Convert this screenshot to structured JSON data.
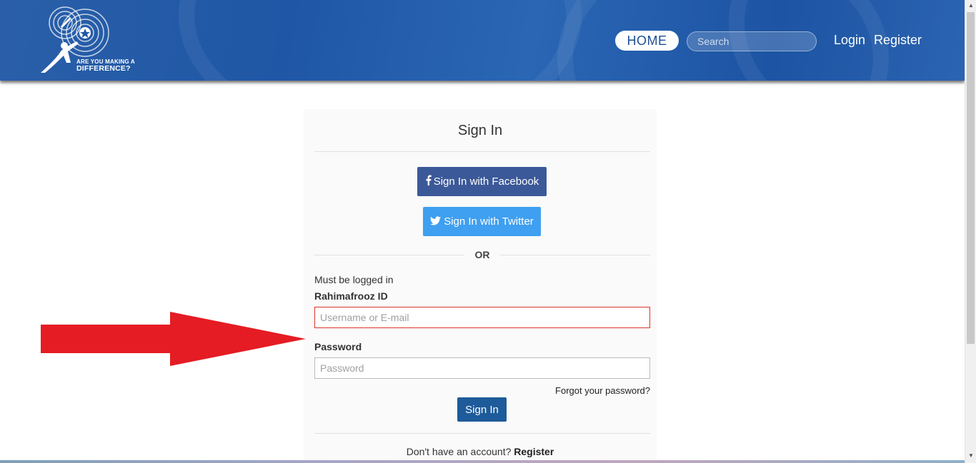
{
  "header": {
    "logo_line1": "ARE YOU MAKING A",
    "logo_line2": "DIFFERENCE?",
    "nav": {
      "home": "HOME",
      "search_placeholder": "Search",
      "login": "Login",
      "register": "Register"
    }
  },
  "signin_card": {
    "title": "Sign In",
    "facebook_button": "Sign In with Facebook",
    "twitter_button": "Sign In with Twitter",
    "or_divider": "OR",
    "notice": "Must be logged in",
    "username_label": "Rahimafrooz ID",
    "username_placeholder": "Username or E-mail",
    "password_label": "Password",
    "password_placeholder": "Password",
    "forgot_link": "Forgot your password?",
    "submit_button": "Sign In",
    "footer_text": "Don't have an account?",
    "footer_register": "Register"
  },
  "colors": {
    "header_blue": "#1f57a6",
    "facebook": "#3b5998",
    "twitter": "#3f9ff0",
    "signin_button": "#1e5b9a",
    "error_border": "#d9352b",
    "arrow_red": "#e51c23"
  },
  "icons": {
    "facebook": "facebook-icon",
    "twitter": "twitter-icon",
    "arrow": "red-arrow-annotation"
  }
}
